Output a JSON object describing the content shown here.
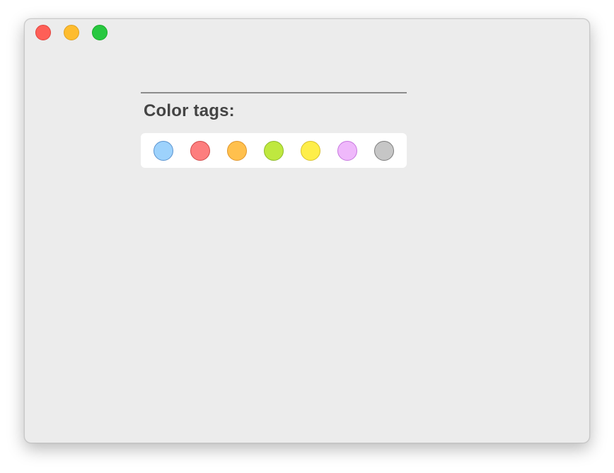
{
  "window": {
    "controls": [
      {
        "name": "close",
        "color": "#fe5f57"
      },
      {
        "name": "minimize",
        "color": "#febc2e"
      },
      {
        "name": "zoom",
        "color": "#28c840"
      }
    ]
  },
  "section": {
    "title": "Color tags:"
  },
  "color_tags": [
    {
      "name": "blue",
      "fill": "#9dd2fc",
      "border": "#5b93cf"
    },
    {
      "name": "red",
      "fill": "#fd7e7e",
      "border": "#d04a4a"
    },
    {
      "name": "orange",
      "fill": "#ffc04d",
      "border": "#e0962c"
    },
    {
      "name": "green",
      "fill": "#bfe83f",
      "border": "#8dba2a"
    },
    {
      "name": "yellow",
      "fill": "#feee4a",
      "border": "#d8c12b"
    },
    {
      "name": "purple",
      "fill": "#efb8fb",
      "border": "#c778df"
    },
    {
      "name": "gray",
      "fill": "#c6c6c6",
      "border": "#7d7d7d"
    }
  ]
}
